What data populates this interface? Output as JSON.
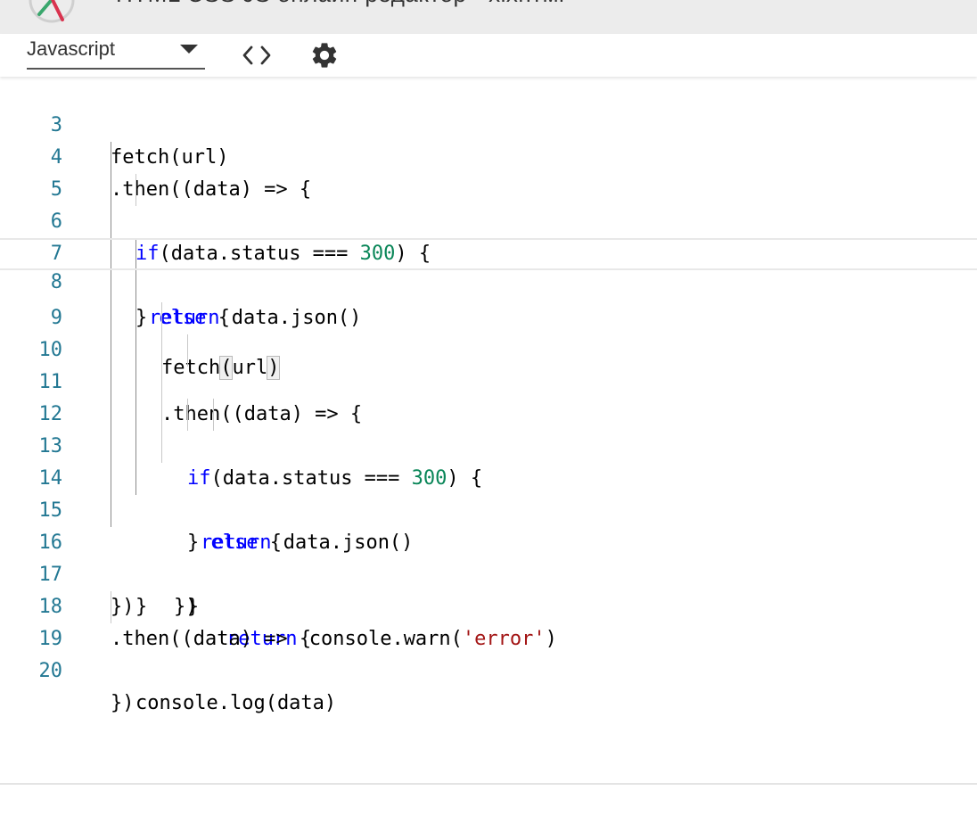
{
  "window": {
    "title": "HTML CSS JS онлайн редактор - хіхнтмі"
  },
  "toolbar": {
    "language": "Javascript",
    "code_icon": "code-brackets-icon",
    "settings_icon": "gear-icon"
  },
  "colors": {
    "keyword": "#0000ff",
    "number": "#098658",
    "string": "#a31515",
    "line_number": "#237893",
    "text": "#000000"
  },
  "editor": {
    "active_line": 8,
    "lines": [
      {
        "n": "3",
        "text": "fetch(url)"
      },
      {
        "n": "4",
        "text": ".then((data) => {"
      },
      {
        "n": "5",
        "text": "if(data.status === 300) {"
      },
      {
        "n": "6",
        "text": "return data.json()"
      },
      {
        "n": "7",
        "text": "} else {"
      },
      {
        "n": "8",
        "text": "fetch(url)"
      },
      {
        "n": "9",
        "text": ".then((data) => {"
      },
      {
        "n": "10",
        "text": "if(data.status === 300) {"
      },
      {
        "n": "11",
        "text": "return data.json()"
      },
      {
        "n": "12",
        "text": "} else {"
      },
      {
        "n": "13",
        "text": "return console.warn('error')"
      },
      {
        "n": "14",
        "text": "}"
      },
      {
        "n": "15",
        "text": "})"
      },
      {
        "n": "16",
        "text": "}"
      },
      {
        "n": "17",
        "text": "})"
      },
      {
        "n": "18",
        "text": ".then((data) => {"
      },
      {
        "n": "19",
        "text": "console.log(data)"
      },
      {
        "n": "20",
        "text": "})"
      }
    ]
  }
}
